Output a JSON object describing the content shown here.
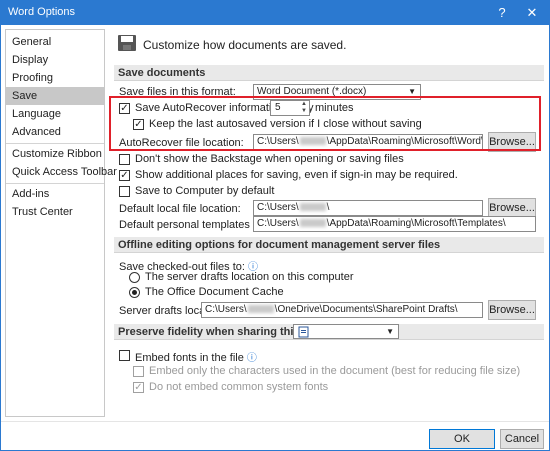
{
  "window": {
    "title": "Word Options",
    "help_glyph": "?",
    "close_glyph": "✕"
  },
  "sidebar": {
    "items": [
      {
        "label": "General"
      },
      {
        "label": "Display"
      },
      {
        "label": "Proofing"
      },
      {
        "label": "Save"
      },
      {
        "label": "Language"
      },
      {
        "label": "Advanced"
      },
      {
        "label": "Customize Ribbon"
      },
      {
        "label": "Quick Access Toolbar"
      },
      {
        "label": "Add-ins"
      },
      {
        "label": "Trust Center"
      }
    ],
    "selected": "Save"
  },
  "header": {
    "text": "Customize how documents are saved."
  },
  "save_documents": {
    "title": "Save documents",
    "format_label": "Save files in this format:",
    "format_value": "Word Document (*.docx)",
    "autorecover_label": "Save AutoRecover information every",
    "autorecover_minutes": "5",
    "minutes_label": "minutes",
    "keep_last_label": "Keep the last autosaved version if I close without saving",
    "autorecover_location_label": "AutoRecover file location:",
    "autorecover_location_prefix": "C:\\Users\\",
    "autorecover_location_suffix": "\\AppData\\Roaming\\Microsoft\\Word\\",
    "browse_label": "Browse...",
    "backstage_label": "Don't show the Backstage when opening or saving files",
    "additional_places_label": "Show additional places for saving, even if sign-in may be required.",
    "save_to_computer_label": "Save to Computer by default",
    "default_local_label": "Default local file location:",
    "default_local_prefix": "C:\\Users\\",
    "default_local_suffix": "\\",
    "default_templates_label": "Default personal templates location:",
    "default_templates_prefix": "C:\\Users\\",
    "default_templates_suffix": "\\AppData\\Roaming\\Microsoft\\Templates\\"
  },
  "offline": {
    "title": "Offline editing options for document management server files",
    "save_checked_out_label": "Save checked-out files to:",
    "server_drafts_option": "The server drafts location on this computer",
    "office_cache_option": "The Office Document Cache",
    "server_drafts_location_label": "Server drafts location:",
    "server_drafts_prefix": "C:\\Users\\",
    "server_drafts_suffix": "\\OneDrive\\Documents\\SharePoint Drafts\\",
    "browse_label": "Browse..."
  },
  "fidelity": {
    "title": "Preserve fidelity when sharing this document:",
    "embed_fonts_label": "Embed fonts in the file",
    "embed_only_used_label": "Embed only the characters used in the document (best for reducing file size)",
    "do_not_embed_common_label": "Do not embed common system fonts"
  },
  "footer": {
    "ok_label": "OK",
    "cancel_label": "Cancel"
  },
  "info_glyph": "ⓘ",
  "check_glyph": "✓",
  "caret_glyph": "▼",
  "spin_up": "▲",
  "spin_down": "▼",
  "colors": {
    "accent": "#2b79d0",
    "highlight": "#e0202a"
  }
}
